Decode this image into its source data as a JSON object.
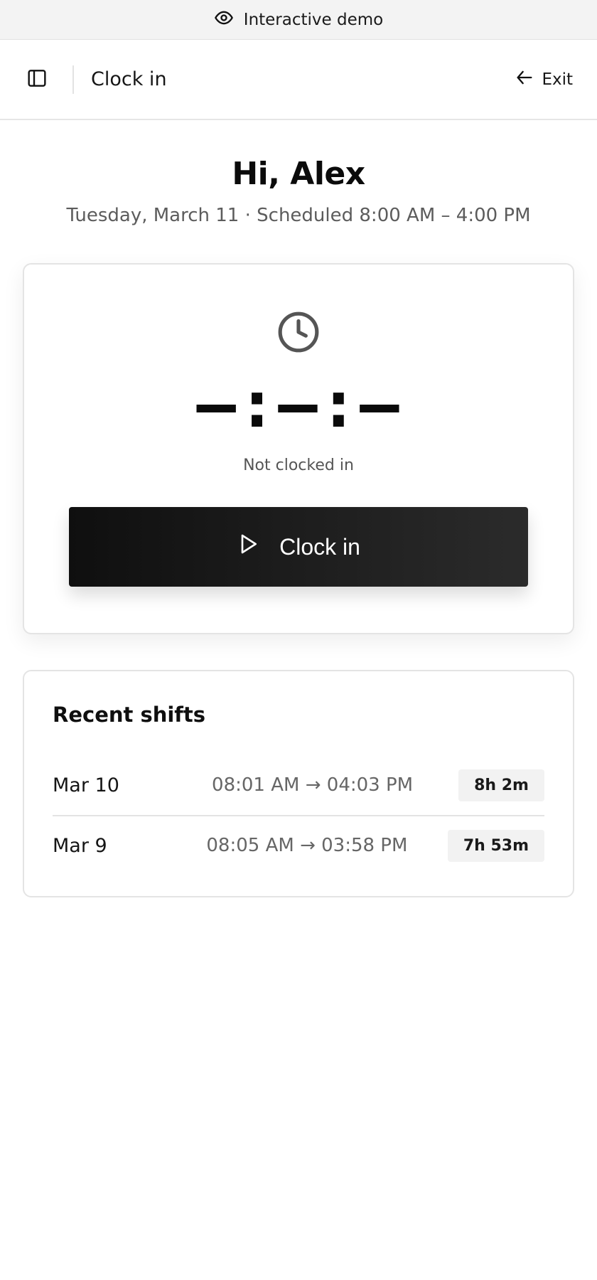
{
  "banner": {
    "label": "Interactive demo",
    "icon": "eye-icon"
  },
  "topbar": {
    "title": "Clock in",
    "exit_label": "Exit"
  },
  "greeting": {
    "title": "Hi, Alex",
    "subline": "Tuesday, March 11 · Scheduled 8:00 AM – 4:00 PM"
  },
  "clock": {
    "timer": "—:—:—",
    "status": "Not clocked in",
    "button_label": "Clock in"
  },
  "shifts": {
    "title": "Recent shifts",
    "rows": [
      {
        "date": "Mar 10",
        "times": "08:01 AM → 04:03 PM",
        "duration": "8h 2m"
      },
      {
        "date": "Mar 9",
        "times": "08:05 AM → 03:58 PM",
        "duration": "7h 53m"
      }
    ]
  },
  "colors": {
    "button_dark": "#111111",
    "badge_bg": "#f2f2f2",
    "muted_text": "#5c5c5c"
  }
}
